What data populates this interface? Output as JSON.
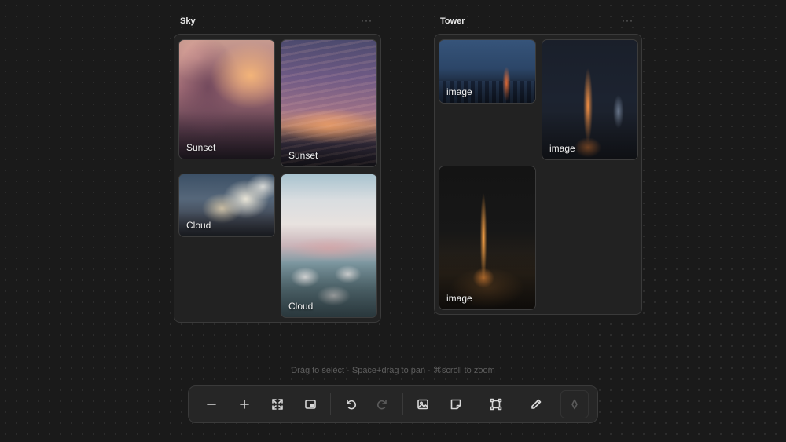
{
  "boards": [
    {
      "title": "Sky",
      "menu": "···",
      "items": [
        {
          "label": "Sunset"
        },
        {
          "label": "Sunset"
        },
        {
          "label": "Cloud"
        },
        {
          "label": "Cloud"
        }
      ]
    },
    {
      "title": "Tower",
      "menu": "···",
      "items": [
        {
          "label": "image"
        },
        {
          "label": "image"
        },
        {
          "label": "image"
        }
      ]
    }
  ],
  "hint": "Drag to select · Space+drag to pan · ⌘scroll to zoom",
  "toolbar": {
    "buttons": [
      {
        "icon": "minus-icon"
      },
      {
        "icon": "plus-icon"
      },
      {
        "icon": "fit-screen-icon"
      },
      {
        "icon": "minimap-icon"
      },
      {
        "icon": "undo-icon"
      },
      {
        "icon": "redo-icon",
        "disabled": true
      },
      {
        "icon": "image-icon"
      },
      {
        "icon": "sticky-note-icon"
      },
      {
        "icon": "frame-icon"
      },
      {
        "icon": "pencil-icon"
      },
      {
        "icon": "diamond-icon",
        "disabled": true
      }
    ]
  },
  "colors": {
    "background": "#1a1a1a",
    "board": "#222222",
    "toolbar": "#262626"
  }
}
